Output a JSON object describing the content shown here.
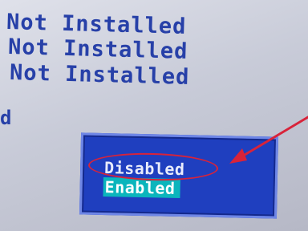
{
  "bios": {
    "status_lines": [
      "Not Installed",
      "Not Installed",
      "Not Installed"
    ],
    "cut_text": "d",
    "options": {
      "disabled_label": "Disabled",
      "enabled_label": "Enabled",
      "selected": "Enabled"
    }
  },
  "colors": {
    "text_blue": "#2740a8",
    "popup_blue": "#1f3fbf",
    "selection_cyan": "#0bb5bc",
    "annotation_red": "#d8233a"
  },
  "icons": {
    "annotation": "arrow-icon"
  }
}
